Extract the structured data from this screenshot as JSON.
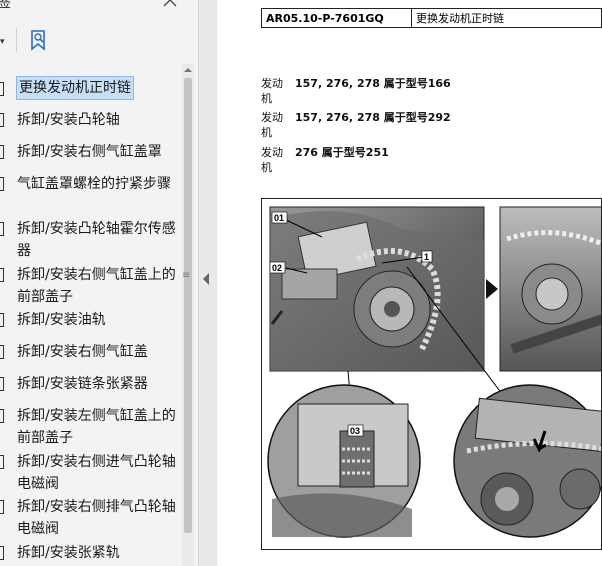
{
  "panel": {
    "title": "签",
    "close_icon": "close-icon",
    "dropdown_icon": "dropdown-arrow-icon",
    "bookmark_tool_icon": "bookmark-search-icon"
  },
  "bookmarks": [
    {
      "label": "更换发动机正时链",
      "selected": true
    },
    {
      "label": "拆卸/安装凸轮轴"
    },
    {
      "label": "拆卸/安装右侧气缸盖罩"
    },
    {
      "label": "气缸盖罩螺栓的拧紧步骤"
    },
    {
      "label": "拆卸/安装凸轮轴霍尔传感器"
    },
    {
      "label": "拆卸/安装右侧气缸盖上的前部盖子"
    },
    {
      "label": "拆卸/安装油轨"
    },
    {
      "label": "拆卸/安装右侧气缸盖"
    },
    {
      "label": "拆卸/安装链条张紧器"
    },
    {
      "label": "拆卸/安装左侧气缸盖上的前部盖子"
    },
    {
      "label": "拆卸/安装右侧进气凸轮轴电磁阀"
    },
    {
      "label": "拆卸/安装右侧排气凸轮轴电磁阀"
    },
    {
      "label": "拆卸/安装张紧轨"
    }
  ],
  "document": {
    "doc_code": "AR05.10-P-7601GQ",
    "doc_title": "更换发动机正时链",
    "applicability": [
      {
        "label": "发动机",
        "value": "157, 276, 278 属于型号166"
      },
      {
        "label": "发动机",
        "value": "157, 276, 278 属于型号292"
      },
      {
        "label": "发动机",
        "value": "276 属于型号251"
      }
    ],
    "figure_callouts": [
      "01",
      "02",
      "1",
      "03"
    ]
  }
}
